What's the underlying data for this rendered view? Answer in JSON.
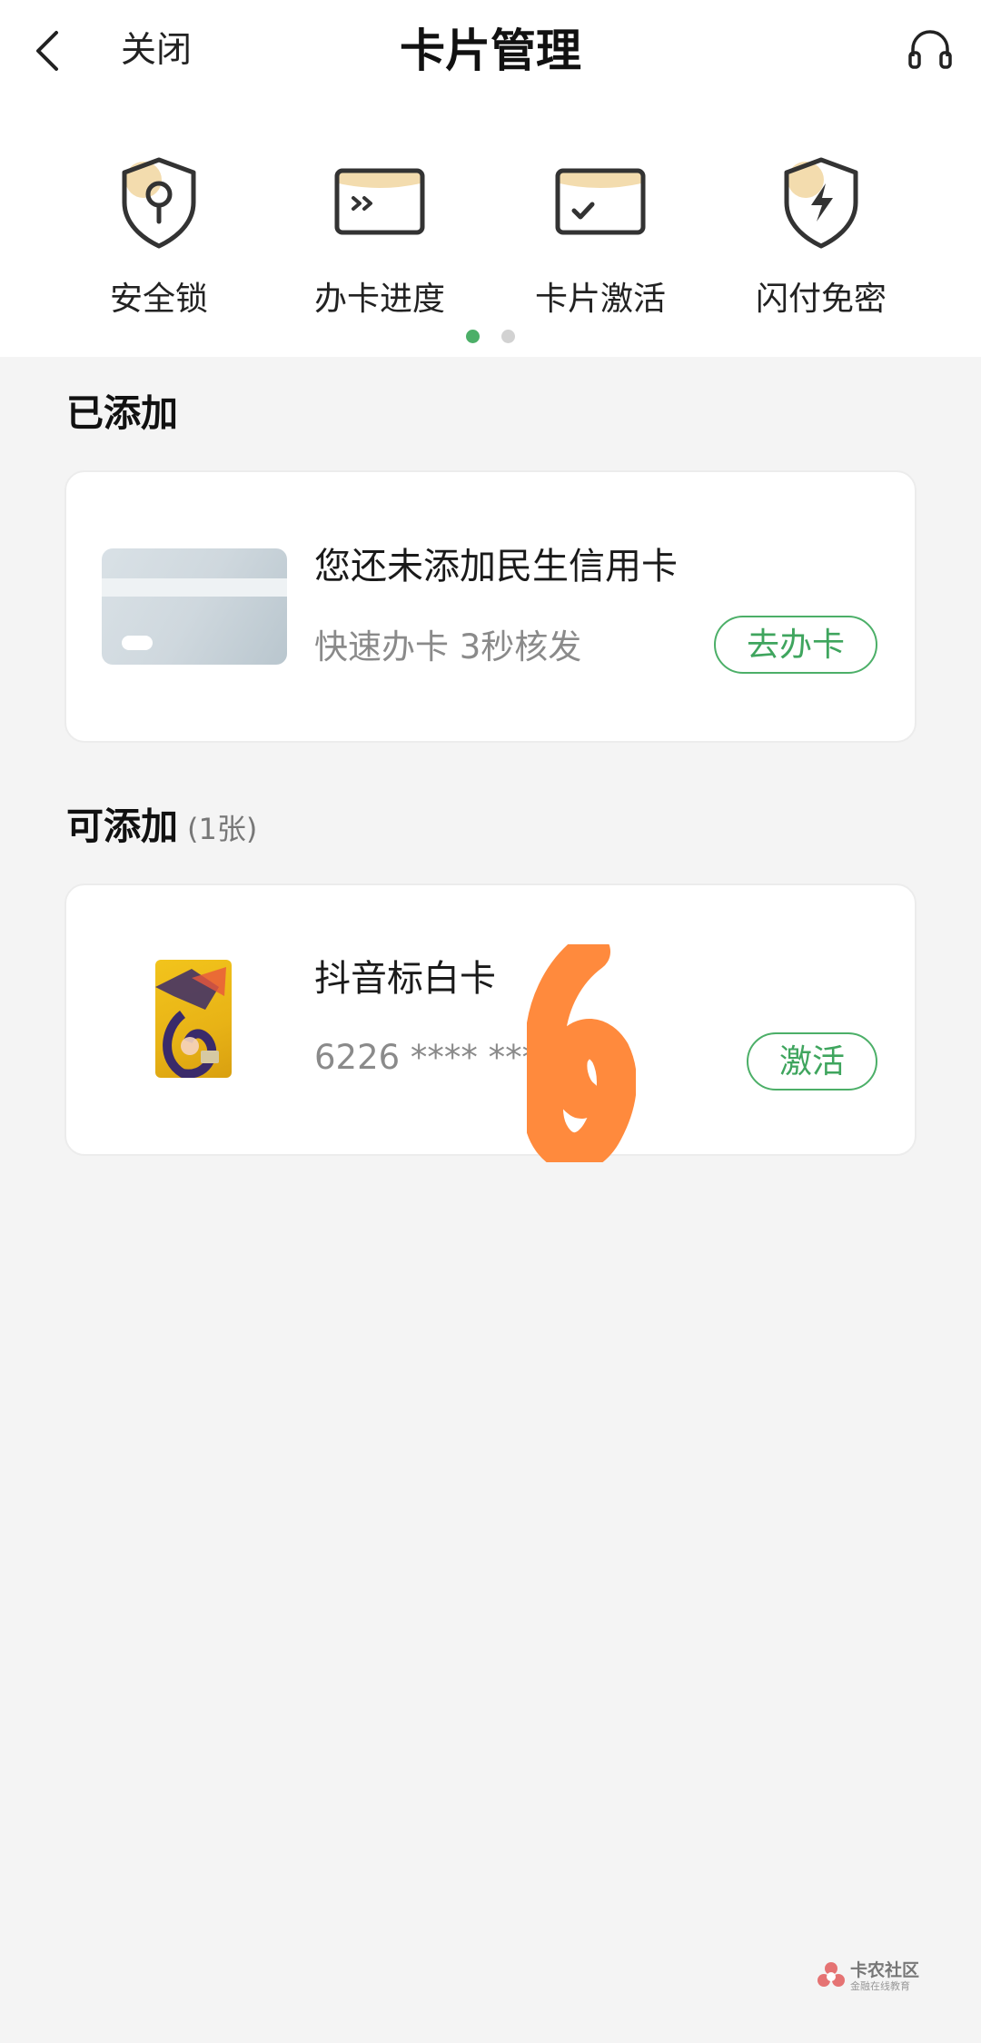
{
  "nav": {
    "back_icon": "chevron-left-icon",
    "close_label": "关闭",
    "title": "卡片管理",
    "support_icon": "headset-icon"
  },
  "quick_actions": [
    {
      "label": "安全锁",
      "icon": "shield-key-icon"
    },
    {
      "label": "办卡进度",
      "icon": "card-progress-icon"
    },
    {
      "label": "卡片激活",
      "icon": "card-check-icon"
    },
    {
      "label": "闪付免密",
      "icon": "shield-lightning-icon"
    }
  ],
  "pager": {
    "pages": 2,
    "active": 0,
    "active_color": "#4caf68",
    "inactive_color": "#d2d2d2"
  },
  "added": {
    "section_title": "已添加",
    "empty_title": "您还未添加民生信用卡",
    "empty_sub": "快速办卡 3秒核发",
    "apply_button": "去办卡"
  },
  "addable": {
    "section_title": "可添加",
    "count": "(1张)",
    "cards": [
      {
        "name": "抖音标白卡",
        "number": "6226 **** ****",
        "action": "激活"
      }
    ]
  },
  "watermark": {
    "main": "卡农社区",
    "sub": "金融在线教育"
  },
  "colors": {
    "accent": "#4caf68",
    "redact": "#ff8a3d"
  }
}
